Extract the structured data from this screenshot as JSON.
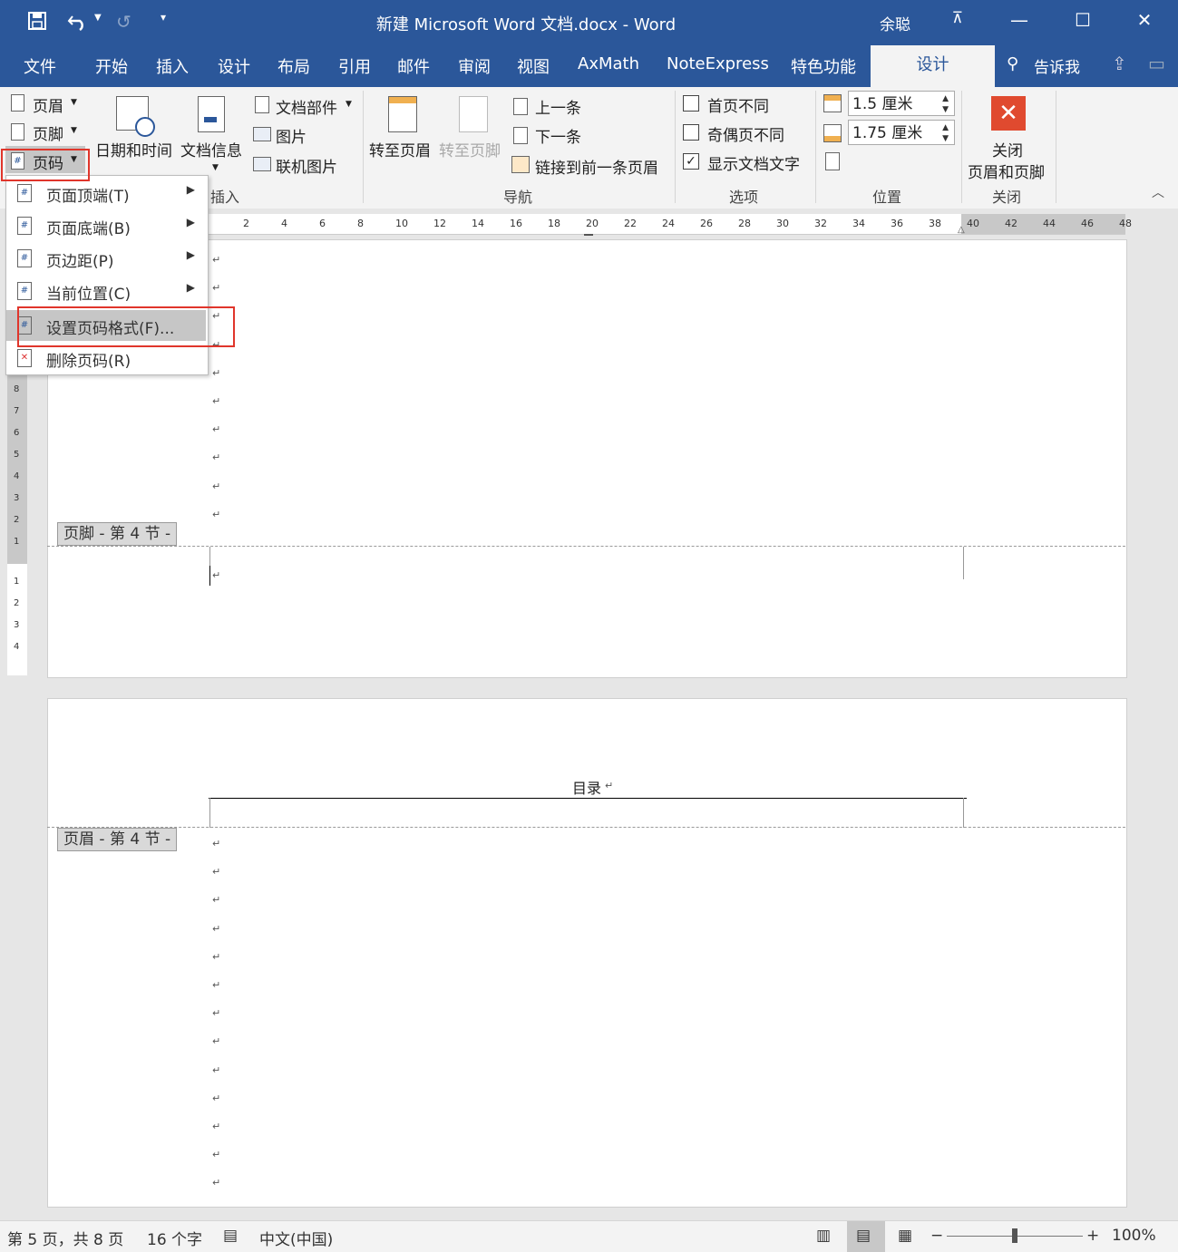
{
  "window": {
    "title": "新建 Microsoft Word 文档.docx  -  Word",
    "user": "余聪"
  },
  "quick_access": {
    "save_icon": "save-icon",
    "undo_icon": "undo-icon",
    "redo_icon": "redo-icon",
    "customize_icon": "customize-icon"
  },
  "tabs": [
    {
      "label": "文件"
    },
    {
      "label": "开始"
    },
    {
      "label": "插入"
    },
    {
      "label": "设计"
    },
    {
      "label": "布局"
    },
    {
      "label": "引用"
    },
    {
      "label": "邮件"
    },
    {
      "label": "审阅"
    },
    {
      "label": "视图"
    },
    {
      "label": "AxMath"
    },
    {
      "label": "NoteExpress"
    },
    {
      "label": "特色功能"
    }
  ],
  "active_tab": "设计",
  "tell_me": "告诉我",
  "ribbon": {
    "header": "页眉",
    "footer": "页脚",
    "page_number": "页码",
    "date_time": "日期和时间",
    "doc_info": "文档信息",
    "doc_parts": "文档部件",
    "picture": "图片",
    "online_picture": "联机图片",
    "insert_group": "插入",
    "goto_header": "转至页眉",
    "goto_footer": "转至页脚",
    "previous": "上一条",
    "next": "下一条",
    "link_previous": "链接到前一条页眉",
    "nav_group": "导航",
    "diff_first": "首页不同",
    "diff_odd_even": "奇偶页不同",
    "show_doc_text": "显示文档文字",
    "options_group": "选项",
    "header_pos": "1.5 厘米",
    "footer_pos": "1.75 厘米",
    "position_group": "位置",
    "close_line1": "关闭",
    "close_line2": "页眉和页脚",
    "close_group": "关闭"
  },
  "checkboxes": {
    "diff_first": false,
    "diff_odd_even": false,
    "show_doc_text": true
  },
  "menu": {
    "items": [
      {
        "label": "页面顶端(T)",
        "has_sub": true
      },
      {
        "label": "页面底端(B)",
        "has_sub": true
      },
      {
        "label": "页边距(P)",
        "has_sub": true
      },
      {
        "label": "当前位置(C)",
        "has_sub": true
      },
      {
        "label": "设置页码格式(F)...",
        "has_sub": false
      },
      {
        "label": "删除页码(R)",
        "has_sub": false
      }
    ]
  },
  "ruler_ticks": [
    "2",
    "4",
    "6",
    "8",
    "10",
    "12",
    "14",
    "16",
    "18",
    "20",
    "22",
    "24",
    "26",
    "28",
    "30",
    "32",
    "34",
    "36",
    "38",
    "40",
    "42",
    "44",
    "46",
    "48"
  ],
  "vruler_ticks": [
    "8",
    "7",
    "6",
    "5",
    "4",
    "3",
    "2",
    "1",
    "1",
    "2",
    "3",
    "4"
  ],
  "document": {
    "footer_tag": "页脚 - 第 4 节 -",
    "header_tag": "页眉 - 第 4 节 -",
    "header_text": "目录",
    "para_mark": "↵"
  },
  "status": {
    "page": "第 5 页，共 8 页",
    "words": "16 个字",
    "language": "中文(中国)",
    "zoom": "100%"
  },
  "colors": {
    "accent": "#2b579a",
    "highlight_box": "#e0352b",
    "close_icon": "#e04a2f"
  }
}
